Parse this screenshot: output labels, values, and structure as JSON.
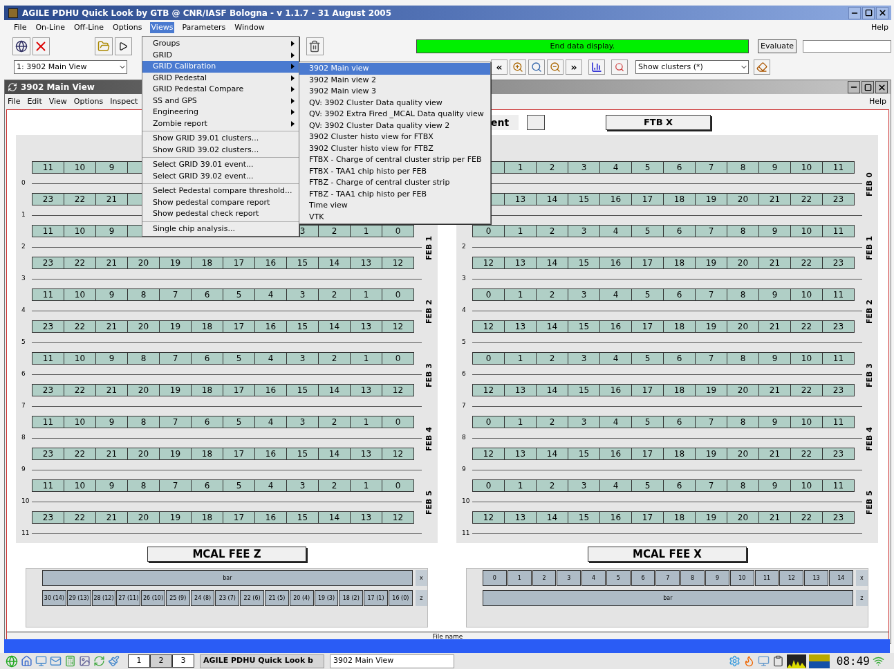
{
  "window": {
    "title": "AGILE PDHU Quick Look by GTB @ CNR/IASF Bologna - v 1.1.7 - 31 August 2005"
  },
  "menubar": [
    {
      "label": "File",
      "selected": false
    },
    {
      "label": "On-Line",
      "selected": false
    },
    {
      "label": "Off-Line",
      "selected": false
    },
    {
      "label": "Options",
      "selected": false
    },
    {
      "label": "Views",
      "selected": true
    },
    {
      "label": "Parameters",
      "selected": false
    },
    {
      "label": "Window",
      "selected": false
    }
  ],
  "help": "Help",
  "status_message": "End data display.",
  "evaluate_button": "Evaluate",
  "view_combo": "1: 3902 Main View",
  "nav_back": "«",
  "nav_forward": "»",
  "cluster_combo": "Show clusters (*)",
  "inner_window": {
    "title": "3902 Main View",
    "menubar": [
      "File",
      "Edit",
      "View",
      "Options",
      "Inspect"
    ],
    "help": "Help",
    "header_fragment": "ent",
    "header_button": "FTB X",
    "panels": [
      {
        "febs": [
          {
            "rows": [
              {
                "cells": [
                  "11",
                  "10",
                  "9",
                  "",
                  null,
                  null,
                  null,
                  null,
                  null,
                  null,
                  null,
                  null
                ],
                "line": "0"
              },
              {
                "cells": [
                  "23",
                  "22",
                  "21",
                  "",
                  null,
                  null,
                  null,
                  null,
                  null,
                  null,
                  null,
                  null
                ],
                "line": "1"
              }
            ]
          },
          {
            "label": "FEB 1",
            "rows": [
              {
                "cells": [
                  "11",
                  "10",
                  "9",
                  "",
                  null,
                  null,
                  null,
                  null,
                  "3",
                  "2",
                  "1",
                  "0"
                ],
                "line": "2"
              },
              {
                "cells": [
                  "23",
                  "22",
                  "21",
                  "20",
                  "19",
                  "18",
                  "17",
                  "16",
                  "15",
                  "14",
                  "13",
                  "12"
                ],
                "line": "3"
              }
            ]
          },
          {
            "label": "FEB 2",
            "rows": [
              {
                "cells": [
                  "11",
                  "10",
                  "9",
                  "8",
                  "7",
                  "6",
                  "5",
                  "4",
                  "3",
                  "2",
                  "1",
                  "0"
                ],
                "line": "4"
              },
              {
                "cells": [
                  "23",
                  "22",
                  "21",
                  "20",
                  "19",
                  "18",
                  "17",
                  "16",
                  "15",
                  "14",
                  "13",
                  "12"
                ],
                "line": "5"
              }
            ]
          },
          {
            "label": "FEB 3",
            "rows": [
              {
                "cells": [
                  "11",
                  "10",
                  "9",
                  "8",
                  "7",
                  "6",
                  "5",
                  "4",
                  "3",
                  "2",
                  "1",
                  "0"
                ],
                "line": "6"
              },
              {
                "cells": [
                  "23",
                  "22",
                  "21",
                  "20",
                  "19",
                  "18",
                  "17",
                  "16",
                  "15",
                  "14",
                  "13",
                  "12"
                ],
                "line": "7"
              }
            ]
          },
          {
            "label": "FEB 4",
            "rows": [
              {
                "cells": [
                  "11",
                  "10",
                  "9",
                  "8",
                  "7",
                  "6",
                  "5",
                  "4",
                  "3",
                  "2",
                  "1",
                  "0"
                ],
                "line": "8"
              },
              {
                "cells": [
                  "23",
                  "22",
                  "21",
                  "20",
                  "19",
                  "18",
                  "17",
                  "16",
                  "15",
                  "14",
                  "13",
                  "12"
                ],
                "line": "9"
              }
            ]
          },
          {
            "label": "FEB 5",
            "rows": [
              {
                "cells": [
                  "11",
                  "10",
                  "9",
                  "8",
                  "7",
                  "6",
                  "5",
                  "4",
                  "3",
                  "2",
                  "1",
                  "0"
                ],
                "line": "10"
              },
              {
                "cells": [
                  "23",
                  "22",
                  "21",
                  "20",
                  "19",
                  "18",
                  "17",
                  "16",
                  "15",
                  "14",
                  "13",
                  "12"
                ],
                "line": "11"
              }
            ]
          }
        ],
        "mcal": {
          "title": "MCAL FEE Z",
          "rows": [
            {
              "kind": "bar",
              "text": "bar",
              "axis": "x"
            },
            {
              "kind": "strips",
              "strips": [
                "30 (14)",
                "29 (13)",
                "28 (12)",
                "27 (11)",
                "26 (10)",
                "25 (9)",
                "24 (8)",
                "23 (7)",
                "22 (6)",
                "21 (5)",
                "20 (4)",
                "19 (3)",
                "18 (2)",
                "17 (1)",
                "16 (0)"
              ],
              "axis": "z"
            }
          ]
        }
      },
      {
        "febs": [
          {
            "label": "FEB 0",
            "rows": [
              {
                "cells": [
                  "",
                  "1",
                  "2",
                  "3",
                  "4",
                  "5",
                  "6",
                  "7",
                  "8",
                  "9",
                  "10",
                  "11"
                ]
              },
              {
                "cells": [
                  "",
                  "13",
                  "14",
                  "15",
                  "16",
                  "17",
                  "18",
                  "19",
                  "20",
                  "21",
                  "22",
                  "23"
                ]
              }
            ]
          },
          {
            "label": "FEB 1",
            "rows": [
              {
                "cells": [
                  "0",
                  "1",
                  "2",
                  "3",
                  "4",
                  "5",
                  "6",
                  "7",
                  "8",
                  "9",
                  "10",
                  "11"
                ],
                "line": "2"
              },
              {
                "cells": [
                  "12",
                  "13",
                  "14",
                  "15",
                  "16",
                  "17",
                  "18",
                  "19",
                  "20",
                  "21",
                  "22",
                  "23"
                ],
                "line": "3"
              }
            ]
          },
          {
            "label": "FEB 2",
            "rows": [
              {
                "cells": [
                  "0",
                  "1",
                  "2",
                  "3",
                  "4",
                  "5",
                  "6",
                  "7",
                  "8",
                  "9",
                  "10",
                  "11"
                ],
                "line": "4"
              },
              {
                "cells": [
                  "12",
                  "13",
                  "14",
                  "15",
                  "16",
                  "17",
                  "18",
                  "19",
                  "20",
                  "21",
                  "22",
                  "23"
                ],
                "line": "5"
              }
            ]
          },
          {
            "label": "FEB 3",
            "rows": [
              {
                "cells": [
                  "0",
                  "1",
                  "2",
                  "3",
                  "4",
                  "5",
                  "6",
                  "7",
                  "8",
                  "9",
                  "10",
                  "11"
                ],
                "line": "6"
              },
              {
                "cells": [
                  "12",
                  "13",
                  "14",
                  "15",
                  "16",
                  "17",
                  "18",
                  "19",
                  "20",
                  "21",
                  "22",
                  "23"
                ],
                "line": "7"
              }
            ]
          },
          {
            "label": "FEB 4",
            "rows": [
              {
                "cells": [
                  "0",
                  "1",
                  "2",
                  "3",
                  "4",
                  "5",
                  "6",
                  "7",
                  "8",
                  "9",
                  "10",
                  "11"
                ],
                "line": "8"
              },
              {
                "cells": [
                  "12",
                  "13",
                  "14",
                  "15",
                  "16",
                  "17",
                  "18",
                  "19",
                  "20",
                  "21",
                  "22",
                  "23"
                ],
                "line": "9"
              }
            ]
          },
          {
            "label": "FEB 5",
            "rows": [
              {
                "cells": [
                  "0",
                  "1",
                  "2",
                  "3",
                  "4",
                  "5",
                  "6",
                  "7",
                  "8",
                  "9",
                  "10",
                  "11"
                ],
                "line": "10"
              },
              {
                "cells": [
                  "12",
                  "13",
                  "14",
                  "15",
                  "16",
                  "17",
                  "18",
                  "19",
                  "20",
                  "21",
                  "22",
                  "23"
                ],
                "line": "11"
              }
            ]
          }
        ],
        "mcal": {
          "title": "MCAL FEE X",
          "rows": [
            {
              "kind": "strips",
              "strips": [
                "0",
                "1",
                "2",
                "3",
                "4",
                "5",
                "6",
                "7",
                "8",
                "9",
                "10",
                "11",
                "12",
                "13",
                "14"
              ],
              "axis": "x"
            },
            {
              "kind": "bar",
              "text": "bar",
              "axis": "z"
            }
          ]
        }
      }
    ],
    "status": "File name"
  },
  "views_menu": {
    "groups": [
      [
        {
          "label": "Groups",
          "submenu": true,
          "selected": false
        },
        {
          "label": "GRID",
          "submenu": true,
          "selected": false
        },
        {
          "label": "GRID Calibration",
          "submenu": true,
          "selected": true
        },
        {
          "label": "GRID Pedestal",
          "submenu": true,
          "selected": false
        },
        {
          "label": "GRID Pedestal Compare",
          "submenu": true,
          "selected": false
        },
        {
          "label": "SS and GPS",
          "submenu": true,
          "selected": false
        },
        {
          "label": "Engineering",
          "submenu": true,
          "selected": false
        },
        {
          "label": "Zombie report",
          "submenu": true,
          "selected": false
        }
      ],
      [
        {
          "label": "Show GRID 39.01 clusters...",
          "submenu": false,
          "selected": false
        },
        {
          "label": "Show GRID 39.02 clusters...",
          "submenu": false,
          "selected": false
        }
      ],
      [
        {
          "label": "Select GRID 39.01 event...",
          "submenu": false,
          "selected": false
        },
        {
          "label": "Select GRID 39.02 event...",
          "submenu": false,
          "selected": false
        }
      ],
      [
        {
          "label": "Select Pedestal compare threshold...",
          "submenu": false,
          "selected": false
        },
        {
          "label": "Show pedestal compare report",
          "submenu": false,
          "selected": false
        },
        {
          "label": "Show pedestal check report",
          "submenu": false,
          "selected": false
        }
      ],
      [
        {
          "label": "Single chip analysis...",
          "submenu": false,
          "selected": false
        }
      ]
    ]
  },
  "submenu": {
    "items": [
      {
        "label": "3902 Main view",
        "selected": true
      },
      {
        "label": "3902 Main view 2",
        "selected": false
      },
      {
        "label": "3902 Main view 3",
        "selected": false
      },
      {
        "label": "QV: 3902 Cluster Data quality view",
        "selected": false
      },
      {
        "label": "QV: 3902 Extra Fired _MCAL Data quality view",
        "selected": false
      },
      {
        "label": "QV: 3902 Cluster Data quality view 2",
        "selected": false
      },
      {
        "label": "3902 Cluster histo view for FTBX",
        "selected": false
      },
      {
        "label": "3902 Cluster histo view for FTBZ",
        "selected": false
      },
      {
        "label": "FTBX - Charge of central cluster strip per FEB",
        "selected": false
      },
      {
        "label": "FTBX - TAA1 chip histo per FEB",
        "selected": false
      },
      {
        "label": "FTBZ - Charge of central cluster strip",
        "selected": false
      },
      {
        "label": "FTBZ - TAA1 chip histo per FEB",
        "selected": false
      },
      {
        "label": "Time view",
        "selected": false
      },
      {
        "label": "VTK",
        "selected": false
      }
    ]
  },
  "taskbar": {
    "desktops": [
      {
        "label": "1",
        "selected": false
      },
      {
        "label": "2",
        "selected": true
      },
      {
        "label": "3",
        "selected": false
      }
    ],
    "tasks": [
      {
        "label": "AGILE PDHU Quick Look b",
        "selected": true
      },
      {
        "label": "3902 Main View",
        "selected": false
      }
    ],
    "clock": "08:49"
  }
}
